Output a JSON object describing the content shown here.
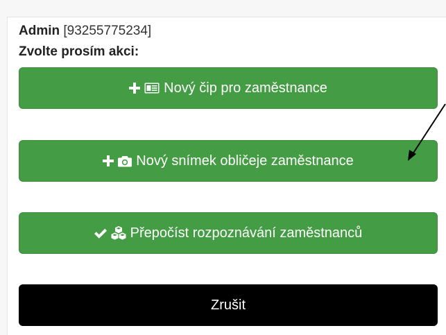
{
  "header": {
    "user_name": "Admin",
    "user_id": "[93255775234]",
    "prompt": "Zvolte prosím akci:"
  },
  "actions": [
    {
      "label": "Nový čip pro zaměstnance",
      "icons": [
        "plus-icon",
        "id-card-icon"
      ]
    },
    {
      "label": "Nový snímek obličeje zaměstnance",
      "icons": [
        "plus-icon",
        "camera-icon"
      ]
    },
    {
      "label": "Přepočíst rozpoznávání zaměstnanců",
      "icons": [
        "checkmark-icon",
        "cubes-icon"
      ]
    }
  ],
  "cancel": {
    "label": "Zrušit"
  },
  "colors": {
    "action_button": "#449d44",
    "cancel_button": "#000000",
    "text_on_button": "#ffffff"
  }
}
